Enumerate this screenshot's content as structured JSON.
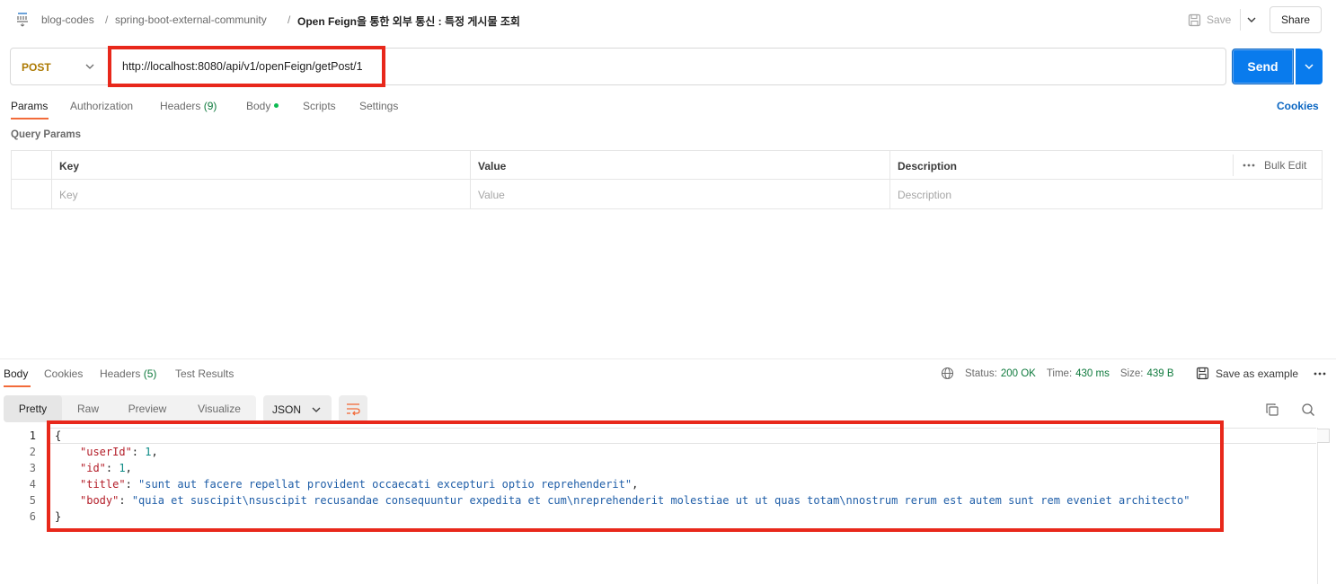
{
  "breadcrumb": {
    "collection": "blog-codes",
    "separator": "/",
    "folder": "spring-boot-external-community",
    "request_name": "Open Feign을 통한 외부 통신 : 특정 게시물 조회"
  },
  "toolbar": {
    "save_label": "Save",
    "share_label": "Share"
  },
  "request": {
    "method": "POST",
    "url": "http://localhost:8080/api/v1/openFeign/getPost/1",
    "send_label": "Send"
  },
  "request_tabs": {
    "params": "Params",
    "authorization": "Authorization",
    "headers": "Headers",
    "headers_count": "(9)",
    "body": "Body",
    "scripts": "Scripts",
    "settings": "Settings",
    "cookies": "Cookies"
  },
  "query_params": {
    "title": "Query Params",
    "columns": [
      "Key",
      "Value",
      "Description"
    ],
    "bulk_edit": "Bulk Edit",
    "placeholders": [
      "Key",
      "Value",
      "Description"
    ]
  },
  "response": {
    "tabs": {
      "body": "Body",
      "cookies": "Cookies",
      "headers": "Headers",
      "headers_count": "(5)",
      "test_results": "Test Results"
    },
    "status_label": "Status:",
    "status_value": "200 OK",
    "time_label": "Time:",
    "time_value": "430 ms",
    "size_label": "Size:",
    "size_value": "439 B",
    "save_example": "Save as example",
    "views": [
      "Pretty",
      "Raw",
      "Preview",
      "Visualize"
    ],
    "format": "JSON",
    "line_numbers": [
      "1",
      "2",
      "3",
      "4",
      "5",
      "6"
    ],
    "json": {
      "open": "{",
      "close": "}",
      "fields": [
        {
          "key": "\"userId\"",
          "value": "1",
          "type": "num",
          "comma": true
        },
        {
          "key": "\"id\"",
          "value": "1",
          "type": "num",
          "comma": true
        },
        {
          "key": "\"title\"",
          "value": "\"sunt aut facere repellat provident occaecati excepturi optio reprehenderit\"",
          "type": "str",
          "comma": true
        },
        {
          "key": "\"body\"",
          "value": "\"quia et suscipit\\nsuscipit recusandae consequuntur expedita et cum\\nreprehenderit molestiae ut ut quas totam\\nnostrum rerum est autem sunt rem eveniet architecto\"",
          "type": "str",
          "comma": false
        }
      ]
    }
  },
  "colors": {
    "accent_orange": "#f26b3a",
    "send_blue": "#097bed",
    "method_post": "#ad7a03",
    "status_green": "#0f7a3d",
    "highlight_red": "#e8281b"
  }
}
